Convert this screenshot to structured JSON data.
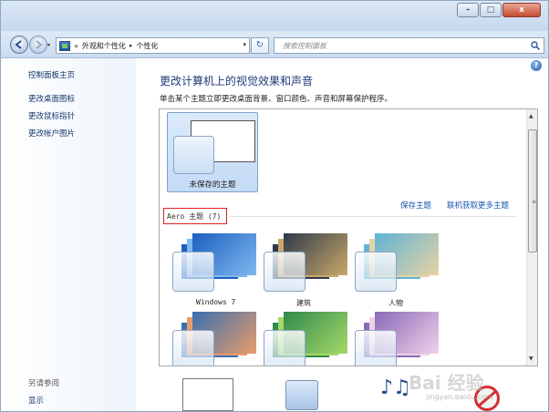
{
  "window": {
    "minimize_glyph": "–",
    "maximize_glyph": "□",
    "close_glyph": "x"
  },
  "nav": {
    "breadcrumb_prefix": "«",
    "crumb_1": "外观和个性化",
    "crumb_sep": "▸",
    "crumb_2": "个性化",
    "dropdown_glyph": "▾",
    "refresh_glyph": "↻",
    "search_placeholder": "搜索控制面板"
  },
  "sidebar": {
    "items": [
      {
        "label": "控制面板主页"
      },
      {
        "label": "更改桌面图标"
      },
      {
        "label": "更改鼠标指针"
      },
      {
        "label": "更改帐户图片"
      }
    ],
    "see_also": "另请参阅",
    "display": "显示"
  },
  "main": {
    "help_glyph": "?",
    "title": "更改计算机上的视觉效果和声音",
    "subtitle": "单击某个主题立即更改桌面背景、窗口颜色、声音和屏幕保护程序。",
    "unsaved_theme": "未保存的主题",
    "save_theme": "保存主题",
    "get_more": "联机获取更多主题",
    "section_title": "Aero 主题 (7)",
    "themes": [
      {
        "label": "Windows 7",
        "color_a": "#1c5fbf",
        "color_b": "#7fb8ef"
      },
      {
        "label": "建筑",
        "color_a": "#2e3a4a",
        "color_b": "#c9a86a"
      },
      {
        "label": "人物",
        "color_a": "#5fb3d6",
        "color_b": "#e6d3a3"
      },
      {
        "label": "",
        "color_a": "#3a6fb0",
        "color_b": "#e89c6a"
      },
      {
        "label": "",
        "color_a": "#2f8a4a",
        "color_b": "#a6d86a"
      },
      {
        "label": "",
        "color_a": "#8a6ab8",
        "color_b": "#f0d0e8"
      }
    ]
  },
  "watermark": {
    "brand": "Bai 经验",
    "url": "jingyan.baidu.com"
  }
}
